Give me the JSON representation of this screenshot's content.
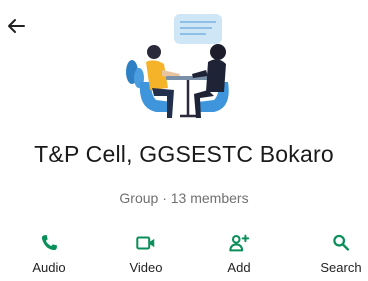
{
  "header": {
    "back_icon": "arrow-left-icon"
  },
  "group": {
    "avatar_icon": "group-avatar-illustration",
    "name": "T&P Cell, GGSESTC Bokaro",
    "meta": "Group · 13 members"
  },
  "actions": [
    {
      "label": "Audio",
      "icon": "phone-icon"
    },
    {
      "label": "Video",
      "icon": "video-camera-icon"
    },
    {
      "label": "Add",
      "icon": "add-person-icon"
    },
    {
      "label": "Search",
      "icon": "search-icon"
    }
  ],
  "colors": {
    "accent": "#0a8f5a",
    "text": "#1a1a1a",
    "subtext": "#707070"
  }
}
